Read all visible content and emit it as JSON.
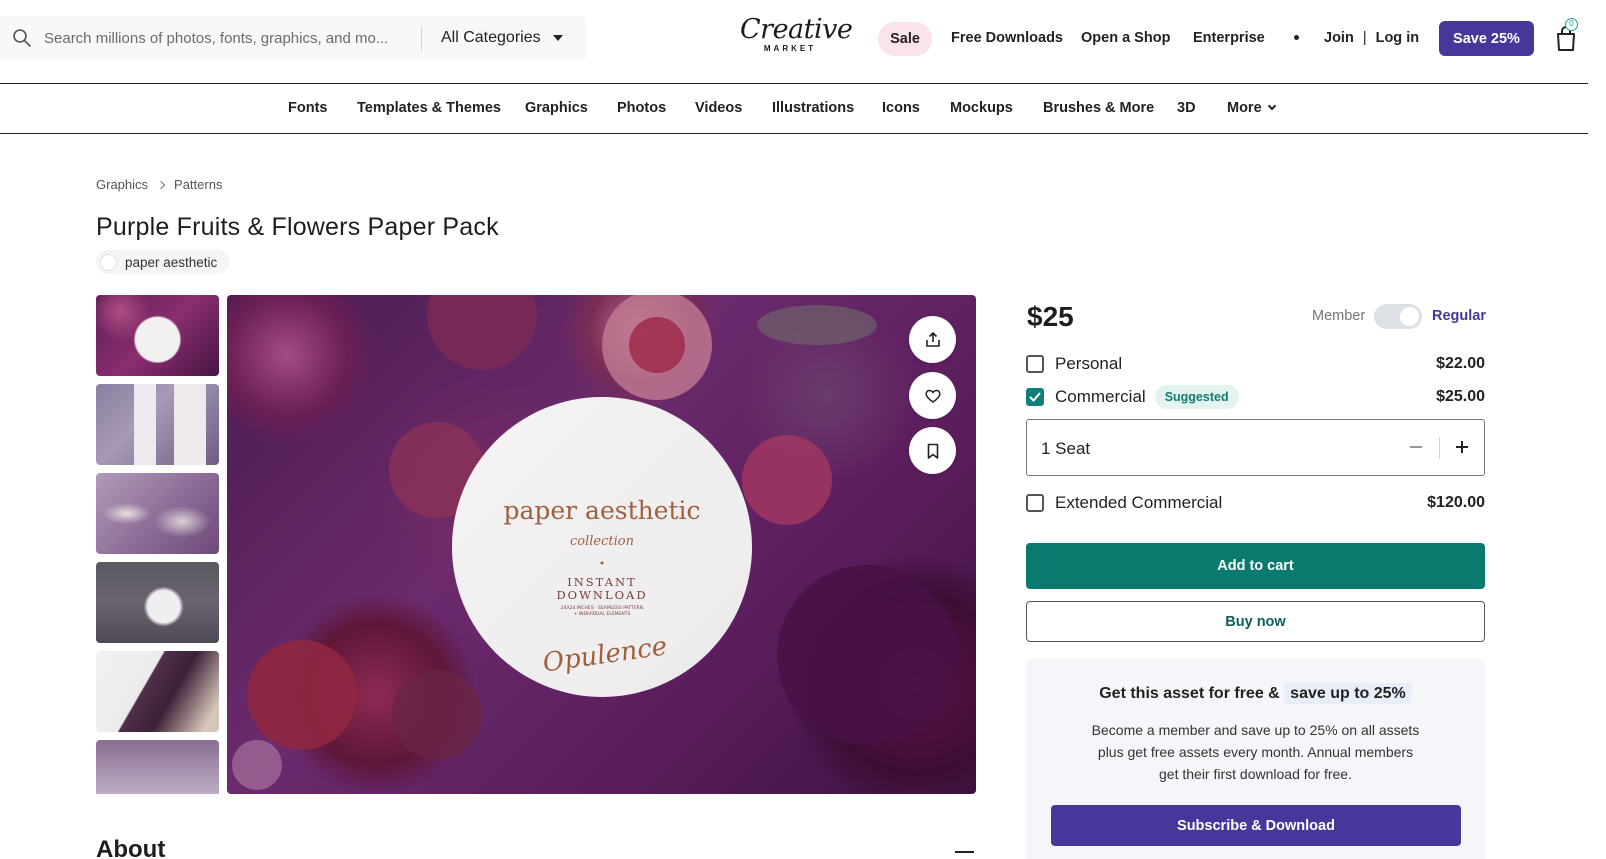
{
  "search": {
    "placeholder": "Search millions of photos, fonts, graphics, and mo...",
    "category": "All Categories"
  },
  "logo": {
    "line1": "Creative",
    "line2": "MARKET"
  },
  "header_nav": {
    "sale": "Sale",
    "free_downloads": "Free Downloads",
    "open_shop": "Open a Shop",
    "enterprise": "Enterprise",
    "join": "Join",
    "separator": "|",
    "login": "Log in",
    "save_button": "Save 25%",
    "cart_count": "0"
  },
  "categories": [
    "Fonts",
    "Templates & Themes",
    "Graphics",
    "Photos",
    "Videos",
    "Illustrations",
    "Icons",
    "Mockups",
    "Brushes & More",
    "3D",
    "More"
  ],
  "breadcrumb": [
    "Graphics",
    "Patterns"
  ],
  "product": {
    "title": "Purple Fruits & Flowers Paper Pack",
    "shop": "paper aesthetic",
    "image_text": {
      "brand": "paper aesthetic",
      "collection": "collection",
      "instant": "INSTANT",
      "download": "DOWNLOAD",
      "details": "24X24 INCHES · SEAMLESS PATTERN",
      "details2": "+ INDIVIDUAL ELEMENTS",
      "signature": "Opulence"
    }
  },
  "about": {
    "heading": "About"
  },
  "pricing": {
    "price": "$25",
    "member_label": "Member",
    "regular_label": "Regular",
    "options": [
      {
        "label": "Personal",
        "price": "$22.00",
        "checked": false
      },
      {
        "label": "Commercial",
        "price": "$25.00",
        "checked": true,
        "badge": "Suggested"
      },
      {
        "label": "Extended Commercial",
        "price": "$120.00",
        "checked": false
      }
    ],
    "seats": "1 Seat",
    "add_to_cart": "Add to cart",
    "buy_now": "Buy now"
  },
  "promo": {
    "heading_prefix": "Get this asset for free &",
    "heading_highlight": "save up to 25%",
    "body": "Become a member and save up to 25% on all assets plus get free assets every month. Annual members get their first download for free.",
    "button": "Subscribe & Download"
  },
  "colors": {
    "brand_purple": "#46389a",
    "teal": "#0a7a6f",
    "sale_pink": "#fbe3ec",
    "checked_teal": "#0f7f79",
    "suggested_bg": "#e3f3ef"
  }
}
